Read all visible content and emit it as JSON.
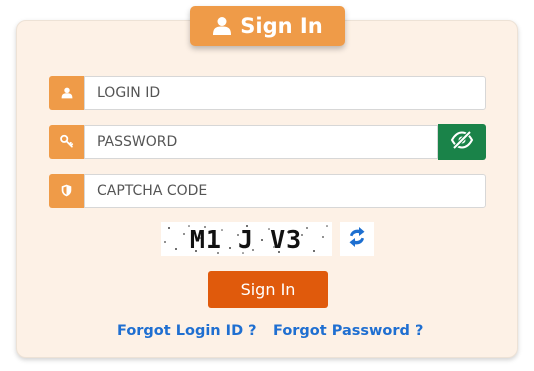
{
  "header": {
    "title": "Sign In",
    "icon": "user-icon"
  },
  "fields": {
    "login_id": {
      "placeholder": "LOGIN ID",
      "icon": "user-icon"
    },
    "password": {
      "placeholder": "PASSWORD",
      "icon": "key-icon",
      "toggle_icon": "eye-slash-icon"
    },
    "captcha": {
      "placeholder": "CAPTCHA CODE",
      "icon": "shield-icon"
    }
  },
  "captcha_image": {
    "text": "M1 J V3",
    "refresh_icon": "refresh-icon"
  },
  "buttons": {
    "submit_label": "Sign In"
  },
  "links": {
    "forgot_login_id": "Forgot Login ID ?",
    "forgot_password": "Forgot Password ?"
  },
  "colors": {
    "accent_orange": "#ef9b48",
    "submit_orange": "#e05a0c",
    "toggle_green": "#1a8349",
    "link_blue": "#1f6fd1",
    "card_background": "#fdf1e6"
  }
}
